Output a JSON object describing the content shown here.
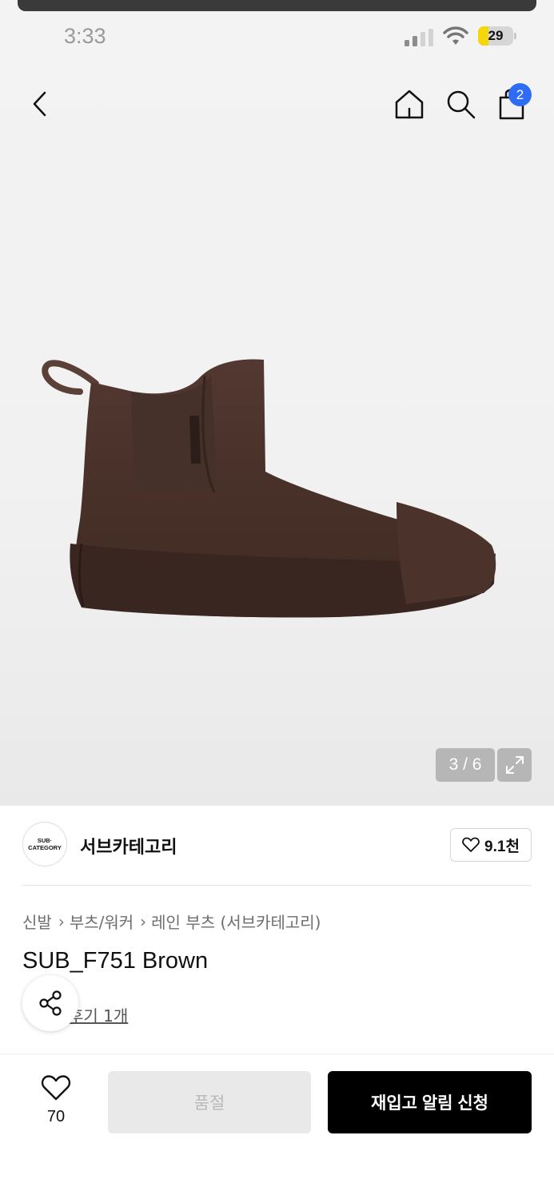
{
  "status_bar": {
    "time": "3:33",
    "battery_percent": "29"
  },
  "header": {
    "cart_count": "2"
  },
  "gallery": {
    "counter": "3 / 6"
  },
  "brand": {
    "logo_line1": "SUB·",
    "logo_line2": "CATEGORY",
    "name": "서브카테고리",
    "like_count": "9.1천"
  },
  "breadcrumb": [
    "신발",
    "부츠/워커",
    "레인 부츠 (서브카테고리)"
  ],
  "product": {
    "title": "SUB_F751 Brown",
    "review_link": "후기 1개"
  },
  "bottom_bar": {
    "wish_count": "70",
    "soldout_label": "품절",
    "restock_label": "재입고 알림 신청"
  },
  "colors": {
    "accent_badge": "#2f6cf6",
    "primary_button": "#000000",
    "boot_brown": "#4a3128"
  }
}
